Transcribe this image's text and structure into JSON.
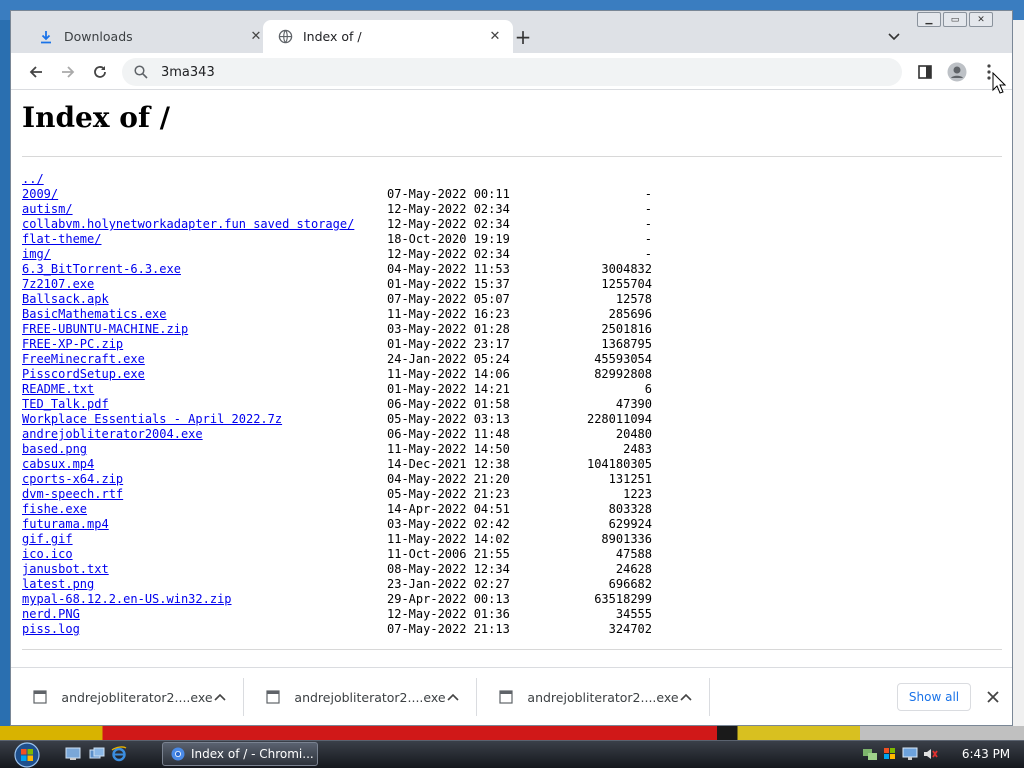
{
  "browser": {
    "tabs": [
      {
        "title": "Downloads",
        "active": false,
        "icon": "download-icon"
      },
      {
        "title": "Index of /",
        "active": true,
        "icon": "globe-icon"
      }
    ],
    "address": "3ma343"
  },
  "page": {
    "heading": "Index of /",
    "entries": [
      {
        "name": "../",
        "date": "",
        "size": ""
      },
      {
        "name": "2009/",
        "date": "07-May-2022 00:11",
        "size": "-"
      },
      {
        "name": "autism/",
        "date": "12-May-2022 02:34",
        "size": "-"
      },
      {
        "name": "collabvm.holynetworkadapter.fun saved storage/",
        "date": "12-May-2022 02:34",
        "size": "-"
      },
      {
        "name": "flat-theme/",
        "date": "18-Oct-2020 19:19",
        "size": "-"
      },
      {
        "name": "img/",
        "date": "12-May-2022 02:34",
        "size": "-"
      },
      {
        "name": "6.3_BitTorrent-6.3.exe",
        "date": "04-May-2022 11:53",
        "size": "3004832"
      },
      {
        "name": "7z2107.exe",
        "date": "01-May-2022 15:37",
        "size": "1255704"
      },
      {
        "name": "Ballsack.apk",
        "date": "07-May-2022 05:07",
        "size": "12578"
      },
      {
        "name": "BasicMathematics.exe",
        "date": "11-May-2022 16:23",
        "size": "285696"
      },
      {
        "name": "FREE-UBUNTU-MACHINE.zip",
        "date": "03-May-2022 01:28",
        "size": "2501816"
      },
      {
        "name": "FREE-XP-PC.zip",
        "date": "01-May-2022 23:17",
        "size": "1368795"
      },
      {
        "name": "FreeMinecraft.exe",
        "date": "24-Jan-2022 05:24",
        "size": "45593054"
      },
      {
        "name": "PisscordSetup.exe",
        "date": "11-May-2022 14:06",
        "size": "82992808"
      },
      {
        "name": "README.txt",
        "date": "01-May-2022 14:21",
        "size": "6"
      },
      {
        "name": "TED_Talk.pdf",
        "date": "06-May-2022 01:58",
        "size": "47390"
      },
      {
        "name": "Workplace Essentials - April 2022.7z",
        "date": "05-May-2022 03:13",
        "size": "228011094"
      },
      {
        "name": "andrejobliterator2004.exe",
        "date": "06-May-2022 11:48",
        "size": "20480"
      },
      {
        "name": "based.png",
        "date": "11-May-2022 14:50",
        "size": "2483"
      },
      {
        "name": "cabsux.mp4",
        "date": "14-Dec-2021 12:38",
        "size": "104180305"
      },
      {
        "name": "cports-x64.zip",
        "date": "04-May-2022 21:20",
        "size": "131251"
      },
      {
        "name": "dvm-speech.rtf",
        "date": "05-May-2022 21:23",
        "size": "1223"
      },
      {
        "name": "fishe.exe",
        "date": "14-Apr-2022 04:51",
        "size": "803328"
      },
      {
        "name": "futurama.mp4",
        "date": "03-May-2022 02:42",
        "size": "629924"
      },
      {
        "name": "gif.gif",
        "date": "11-May-2022 14:02",
        "size": "8901336"
      },
      {
        "name": "ico.ico",
        "date": "11-Oct-2006 21:55",
        "size": "47588"
      },
      {
        "name": "janusbot.txt",
        "date": "08-May-2022 12:34",
        "size": "24628"
      },
      {
        "name": "latest.png",
        "date": "23-Jan-2022 02:27",
        "size": "696682"
      },
      {
        "name": "mypal-68.12.2.en-US.win32.zip",
        "date": "29-Apr-2022 00:13",
        "size": "63518299"
      },
      {
        "name": "nerd.PNG",
        "date": "12-May-2022 01:36",
        "size": "34555"
      },
      {
        "name": "piss.log",
        "date": "07-May-2022 21:13",
        "size": "324702"
      }
    ]
  },
  "downloads": {
    "items": [
      {
        "name": "andrejobliterator2....exe"
      },
      {
        "name": "andrejobliterator2....exe"
      },
      {
        "name": "andrejobliterator2....exe"
      }
    ],
    "show_all": "Show all"
  },
  "taskbar": {
    "task_label": "Index of / - Chromi...",
    "clock": "6:43 PM"
  },
  "colors": {
    "link": "#0000ee",
    "accent": "#1a73e8",
    "tabstrip": "#dee1e6"
  }
}
